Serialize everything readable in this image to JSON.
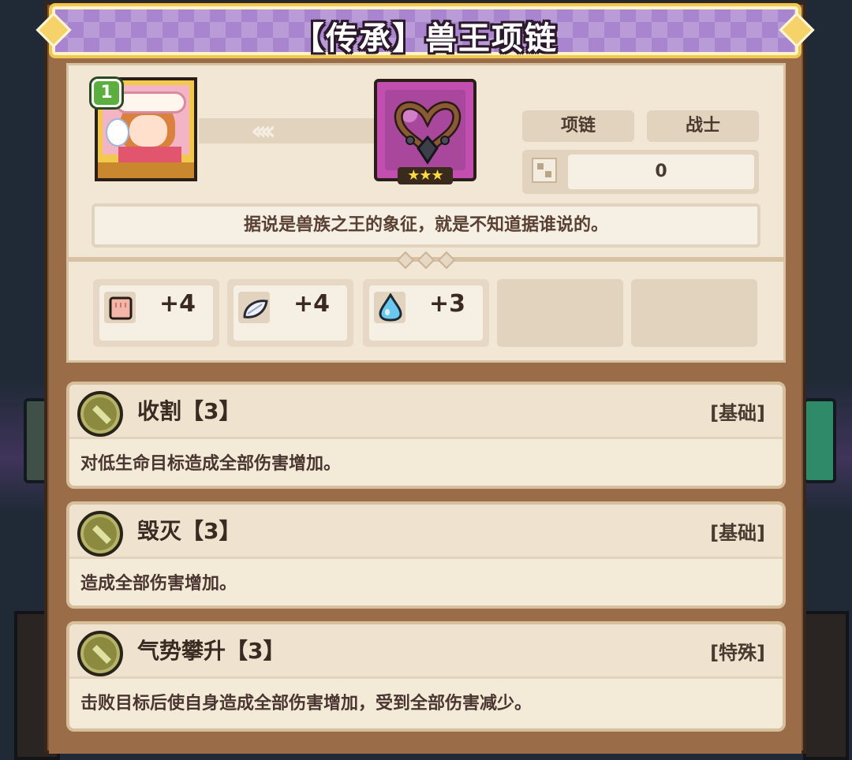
{
  "title": "【传承】兽王项链",
  "hero": {
    "level": "1"
  },
  "item": {
    "slot_type": "项链",
    "class_tag": "战士",
    "count": "0",
    "stars": "★★★",
    "description": "据说是兽族之王的象征，就是不知道据谁说的。"
  },
  "stats": [
    {
      "icon": "fist-icon",
      "value": "+4"
    },
    {
      "icon": "feather-icon",
      "value": "+4"
    },
    {
      "icon": "water-drop-icon",
      "value": "+3"
    }
  ],
  "skills": [
    {
      "name": "收割【3】",
      "type": "[基础]",
      "description": "对低生命目标造成全部伤害增加。"
    },
    {
      "name": "毁灭【3】",
      "type": "[基础]",
      "description": "造成全部伤害增加。"
    },
    {
      "name": "气势攀升【3】",
      "type": "[特殊]",
      "description": "击败目标后使自身造成全部伤害增加，受到全部伤害减少。"
    }
  ],
  "colors": {
    "title_bg": "#a985cf",
    "title_border": "#f0c850",
    "panel_bg": "#f2e6d4",
    "item_bg": "#c24fb0"
  }
}
